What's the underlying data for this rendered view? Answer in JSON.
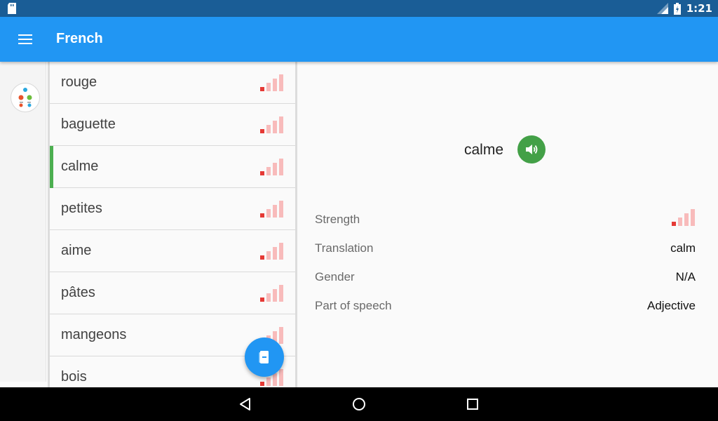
{
  "status_bar": {
    "time": "1:21"
  },
  "app_bar": {
    "title": "French"
  },
  "words": [
    {
      "label": "rouge",
      "selected": false
    },
    {
      "label": "baguette",
      "selected": false
    },
    {
      "label": "calme",
      "selected": true
    },
    {
      "label": "petites",
      "selected": false
    },
    {
      "label": "aime",
      "selected": false
    },
    {
      "label": "pâtes",
      "selected": false
    },
    {
      "label": "mangeons",
      "selected": false
    },
    {
      "label": "bois",
      "selected": false
    }
  ],
  "detail": {
    "word": "calme",
    "properties": [
      {
        "label": "Strength",
        "value": ""
      },
      {
        "label": "Translation",
        "value": "calm"
      },
      {
        "label": "Gender",
        "value": "N/A"
      },
      {
        "label": "Part of speech",
        "value": "Adjective"
      }
    ]
  },
  "colors": {
    "primary": "#2196f3",
    "status_bar": "#1a5d96",
    "selected_accent": "#4caf50",
    "speak_button": "#43a047",
    "strength_active": "#e53935",
    "strength_inactive": "#f8bbbb"
  },
  "strength": {
    "level": 1,
    "max": 4
  },
  "icons": {
    "menu": "hamburger-menu-icon",
    "speak": "volume-icon",
    "fab": "book-icon",
    "nav_back": "triangle-back-icon",
    "nav_home": "circle-home-icon",
    "nav_recents": "square-recents-icon"
  }
}
